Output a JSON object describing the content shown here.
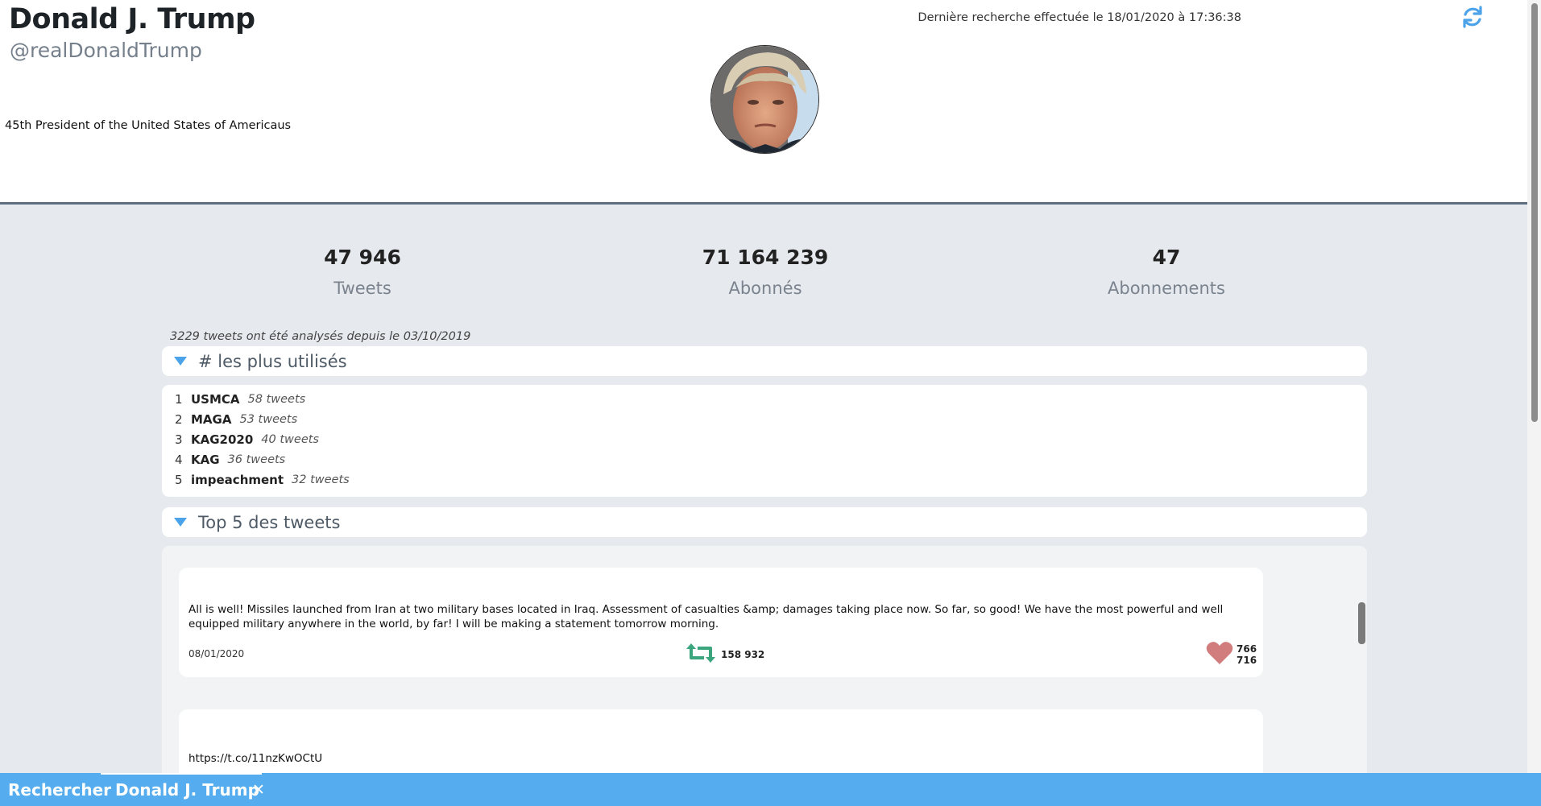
{
  "profile": {
    "name": "Donald J. Trump",
    "handle": "@realDonaldTrump",
    "bio": "45th President of the United States of Americaus",
    "last_search": "Dernière recherche effectuée le 18/01/2020 à 17:36:38"
  },
  "stats": [
    {
      "value": "47 946",
      "label": "Tweets"
    },
    {
      "value": "71 164 239",
      "label": "Abonnés"
    },
    {
      "value": "47",
      "label": "Abonnements"
    }
  ],
  "analysis_note": "3229 tweets ont été analysés depuis le 03/10/2019",
  "hashtags_panel": {
    "title": "# les plus utilisés",
    "items": [
      {
        "rank": "1",
        "tag": "USMCA",
        "count": "58 tweets"
      },
      {
        "rank": "2",
        "tag": "MAGA",
        "count": "53 tweets"
      },
      {
        "rank": "3",
        "tag": "KAG2020",
        "count": "40 tweets"
      },
      {
        "rank": "4",
        "tag": "KAG",
        "count": "36 tweets"
      },
      {
        "rank": "5",
        "tag": "impeachment",
        "count": "32 tweets"
      }
    ]
  },
  "tweets_panel": {
    "title": "Top 5 des tweets",
    "tweets": [
      {
        "text": "All is well! Missiles launched from Iran at two military bases located in Iraq. Assessment of casualties &amp; damages taking place now. So far, so good! We have the most powerful and well equipped military anywhere in the world, by far! I will be making a statement tomorrow morning.",
        "date": "08/01/2020",
        "retweets": "158 932",
        "likes": "766 716"
      },
      {
        "text": "https://t.co/11nzKwOCtU"
      }
    ]
  },
  "tabs": [
    {
      "label": "Rechercher"
    },
    {
      "label": "Donald J. Trump"
    }
  ],
  "colors": {
    "accent": "#55acee",
    "retweet": "#3ba57e",
    "like": "#d27d7d",
    "divider": "#5d6f7e"
  },
  "icons": {
    "refresh": "refresh-icon",
    "collapse": "caret-down-icon",
    "retweet": "retweet-icon",
    "like": "heart-icon",
    "close": "close-icon"
  }
}
